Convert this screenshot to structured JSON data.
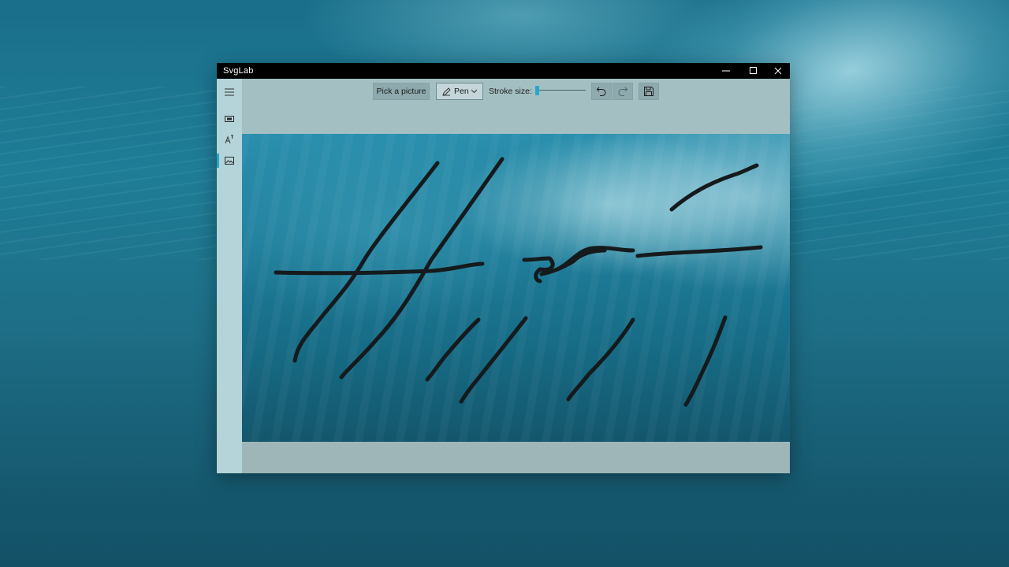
{
  "window": {
    "title": "SvgLab"
  },
  "toolbar": {
    "pick_label": "Pick a picture",
    "pen_label": "Pen",
    "stroke_label": "Stroke size:",
    "stroke_size_fraction": 0.03
  },
  "icons": {
    "menu": "hamburger-icon",
    "nav1": "video-screen-icon",
    "nav2": "text-effect-icon",
    "nav3": "image-icon",
    "pen": "pen-icon",
    "undo": "undo-icon",
    "redo": "redo-icon",
    "save": "save-icon",
    "minimize": "minimize-icon",
    "maximize": "maximize-icon",
    "close": "close-icon"
  },
  "colors": {
    "accent": "#2aa6c7",
    "ink": "#151a1c"
  }
}
